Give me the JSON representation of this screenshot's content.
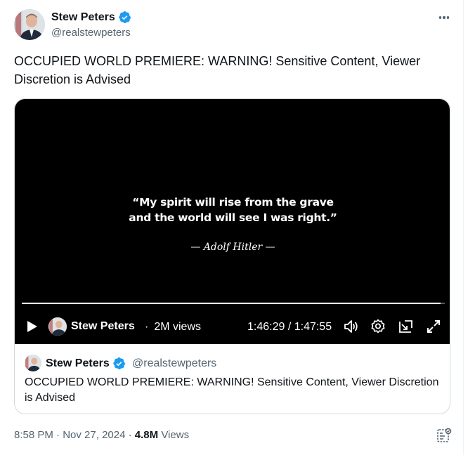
{
  "author": {
    "name": "Stew Peters",
    "handle": "@realstewpeters",
    "verified": true,
    "verified_color": "#1d9bf0"
  },
  "more_icon": "more-horizontal-icon",
  "tweet": {
    "text": "OCCUPIED WORLD PREMIERE: WARNING! Sensitive Content, Viewer Discretion is Advised"
  },
  "video": {
    "quote_line1": "“My spirit will rise from the grave",
    "quote_line2": "and the world will see I was right.”",
    "quote_author": "— Adolf Hitler —",
    "progress": 0.99,
    "controls": {
      "channel_name": "Stew Peters",
      "separator": "·",
      "views": "2M views",
      "time": "1:46:29 / 1:47:55",
      "icons": [
        "play-icon",
        "volume-icon",
        "settings-icon",
        "pip-icon",
        "fullscreen-icon"
      ]
    }
  },
  "quoted": {
    "name": "Stew Peters",
    "handle": "@realstewpeters",
    "text": "OCCUPIED WORLD PREMIERE: WARNING! Sensitive Content, Viewer Discretion is Advised"
  },
  "meta": {
    "time": "8:58 PM",
    "sep1": " · ",
    "date": "Nov 27, 2024",
    "sep2": " · ",
    "views_count": "4.8M",
    "views_label": " Views"
  },
  "analytics_icon": "analytics-icon",
  "colors": {
    "text": "#0f1419",
    "secondary": "#536471",
    "border": "#cfd9de",
    "video_bg": "#000000"
  }
}
